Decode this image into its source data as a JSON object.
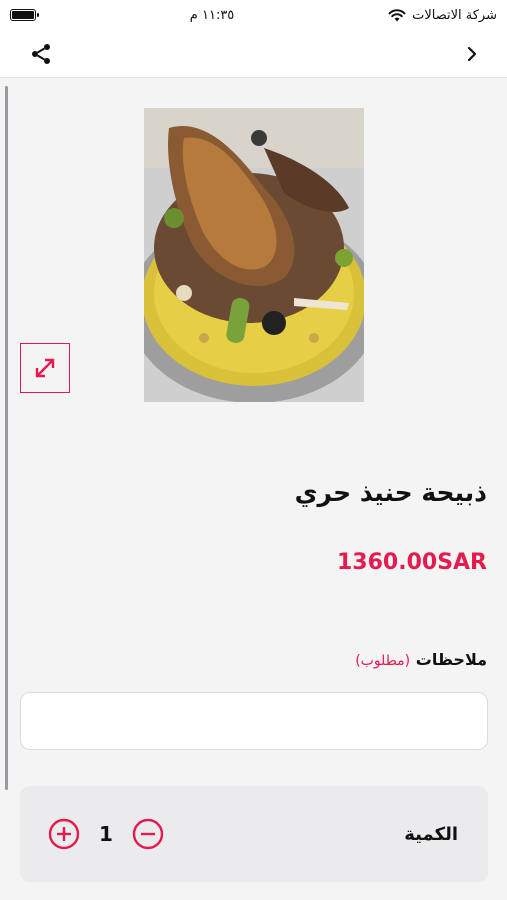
{
  "status_bar": {
    "carrier": "شركة الاتصالات",
    "time": "١١:٣٥ م"
  },
  "nav": {
    "back_icon": "chevron-right-icon",
    "share_icon": "share-icon"
  },
  "product": {
    "image_alt": "Mandi lamb platter on yellow rice",
    "title": "ذبيحة حنيذ حري",
    "price": "1360.00SAR"
  },
  "notes": {
    "label": "ملاحظات",
    "required": "(مطلوب)",
    "value": "",
    "placeholder": ""
  },
  "quantity": {
    "label": "الكمية",
    "value": "1"
  },
  "colors": {
    "accent": "#e31b4f",
    "background": "#f4f4f5",
    "card": "#ebebee"
  }
}
